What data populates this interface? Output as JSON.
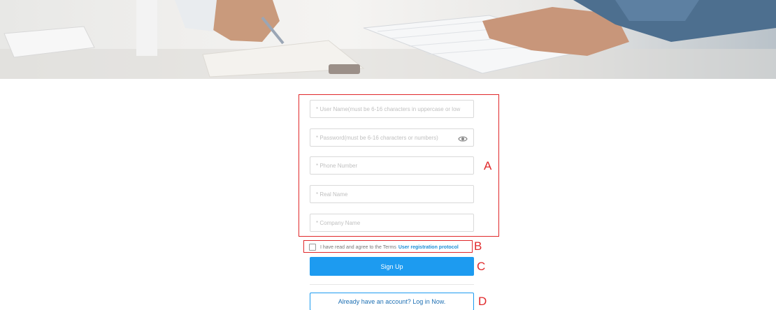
{
  "form": {
    "username_placeholder": "* User Name(must be 6-16 characters in uppercase or low",
    "password_placeholder": "* Password(must be 6-16 characters or numbers)",
    "phone_placeholder": "* Phone Number",
    "realname_placeholder": "* Real Name",
    "company_placeholder": "* Company Name",
    "password_toggle_icon": "eye-icon"
  },
  "agreement": {
    "text": "I have read and agree to the Terms",
    "link": "User registration protocol"
  },
  "buttons": {
    "signup": "Sign Up",
    "login": "Already have an account? Log in Now."
  },
  "annotations": {
    "a": "A",
    "b": "B",
    "c": "C",
    "d": "D",
    "color": "#e0282a"
  },
  "colors": {
    "primary": "#1d9bf0",
    "link": "#1e8fd6"
  }
}
